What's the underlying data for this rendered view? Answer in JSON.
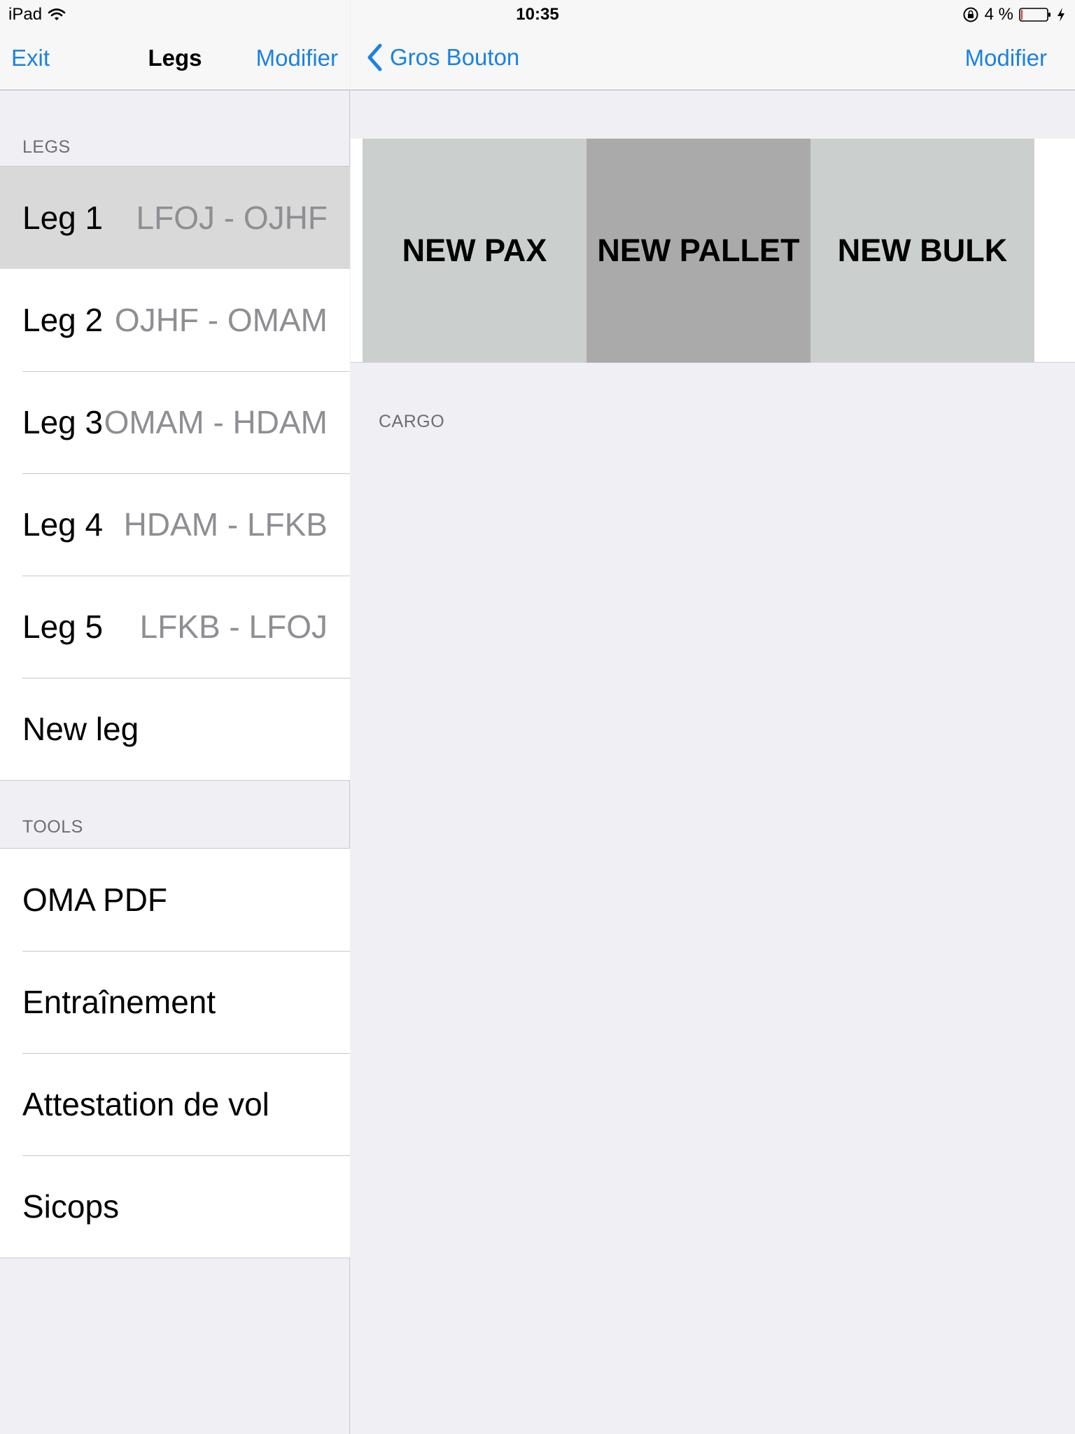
{
  "status_bar": {
    "device": "iPad",
    "time": "10:35",
    "battery": "4 %"
  },
  "master": {
    "left_button": "Exit",
    "title": "Legs",
    "right_button": "Modifier",
    "legs_header": "LEGS",
    "legs": [
      {
        "label": "Leg 1",
        "route": "LFOJ - OJHF"
      },
      {
        "label": "Leg 2",
        "route": "OJHF - OMAM"
      },
      {
        "label": "Leg 3",
        "route": "OMAM - HDAM"
      },
      {
        "label": "Leg 4",
        "route": "HDAM - LFKB"
      },
      {
        "label": "Leg 5",
        "route": "LFKB - LFOJ"
      }
    ],
    "new_leg": "New leg",
    "tools_header": "TOOLS",
    "tools": [
      "OMA PDF",
      "Entraînement",
      "Attestation de vol",
      "Sicops"
    ]
  },
  "detail": {
    "back_label": "Gros Bouton",
    "right_button": "Modifier",
    "buttons": [
      {
        "label": "NEW PAX",
        "color": "#cbd0cf"
      },
      {
        "label": "NEW PALLET",
        "color": "#aaaaaa"
      },
      {
        "label": "NEW BULK",
        "color": "#cbd0cf"
      }
    ],
    "cargo_header": "CARGO"
  },
  "colors": {
    "accent": "#1a82e2",
    "selected_cell": "#d9d9d9",
    "background": "#efeff4"
  },
  "icons": [
    "wifi-icon",
    "orientation-lock-icon",
    "battery-icon",
    "charging-bolt-icon",
    "back-chevron-icon"
  ]
}
